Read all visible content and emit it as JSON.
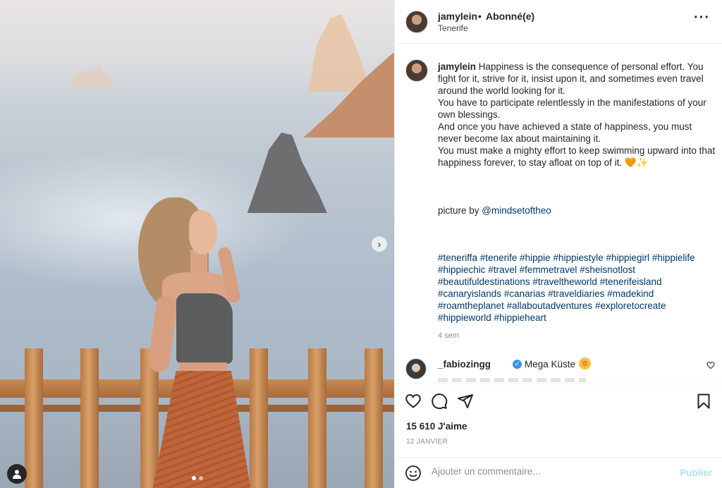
{
  "header": {
    "username": "jamylein",
    "separator": "•",
    "follow_status": "Abonné(e)",
    "location": "Tenerife",
    "more_icon": "more-horizontal-icon"
  },
  "caption": {
    "username": "jamylein",
    "para1": "Happiness is the consequence of personal effort. You fight for it, strive for it, insist upon it, and sometimes even travel around the world looking for it.",
    "para2": "You have to participate relentlessly in the manifestations of your own blessings.",
    "para3": "And once you have achieved a state of happiness, you must never become lax about maintaining it.",
    "para4": "You must make a mighty effort to keep swimming upward into that happiness forever, to stay afloat on top of it. 🧡✨",
    "credit_prefix": "picture by",
    "credit_handle": "@mindsetoftheo",
    "hashtags": [
      "#teneriffa",
      "#tenerife",
      "#hippie",
      "#hippiestyle",
      "#hippiegirl",
      "#hippielife",
      "#hippiechic",
      "#travel",
      "#femmetravel",
      "#sheisnotlost",
      "#beautifuldestinations",
      "#traveltheworld",
      "#tenerifeisland",
      "#canaryislands",
      "#canarias",
      "#traveldiaries",
      "#madekind",
      "#roamtheplanet",
      "#allaboutadventures",
      "#exploretocreate",
      "#hippieworld",
      "#hippieheart"
    ],
    "time_ago": "4 sem"
  },
  "comment": {
    "username": "_fabiozingg",
    "verified_mark": "✓",
    "text": "Mega Küste",
    "emoji": "😍"
  },
  "actions": {
    "like_icon": "heart-icon",
    "comment_icon": "comment-icon",
    "share_icon": "share-icon",
    "save_icon": "bookmark-icon",
    "likes": "15 610 J'aime",
    "date": "12 JANVIER"
  },
  "add_comment": {
    "placeholder": "Ajouter un commentaire...",
    "publish": "Publier"
  },
  "media": {
    "next_icon": "chevron-right-icon",
    "carousel_total": 2,
    "carousel_active": 1
  },
  "colors": {
    "link": "#00376b",
    "publish_disabled": "#b2dffc",
    "verified": "#3897f0"
  }
}
